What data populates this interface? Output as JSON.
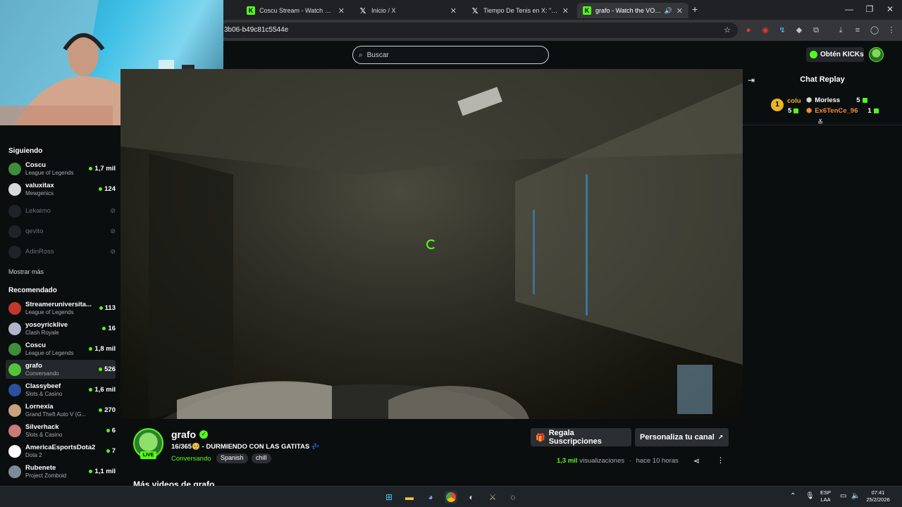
{
  "browser": {
    "tabs": [
      {
        "title": "Coscu Stream - Watch Live on K",
        "icon": "kick-favicon",
        "active": false
      },
      {
        "title": "Inicio / X",
        "icon": "x-favicon",
        "active": false
      },
      {
        "title": "Tiempo De Tenis en X: \"🤯 EL E",
        "icon": "x-favicon",
        "active": false
      },
      {
        "title": "grafo - Watch the VOD on K",
        "icon": "kick-favicon",
        "active": true
      }
    ],
    "new_tab": "+",
    "url": "3b06-b49c81c5544e"
  },
  "site": {
    "search_placeholder": "Buscar",
    "kicks_button": "Obtén KICKs"
  },
  "sidebar": {
    "following_title": "Siguiendo",
    "following": [
      {
        "name": "Coscu",
        "category": "League of Legends",
        "viewers": "1,7 mil",
        "live": true,
        "color": "#3e8e3a"
      },
      {
        "name": "valuxitax",
        "category": "Mewgenics",
        "viewers": "124",
        "live": true,
        "color": "#d9d9d9"
      },
      {
        "name": "Lekaimo",
        "category": "",
        "viewers": "",
        "live": false,
        "color": "#8a8f93"
      },
      {
        "name": "qevito",
        "category": "",
        "viewers": "",
        "live": false,
        "color": "#8a8f93"
      },
      {
        "name": "AdinRoss",
        "category": "",
        "viewers": "",
        "live": false,
        "color": "#8a8f93"
      }
    ],
    "show_more": "Mostrar más",
    "recommended_title": "Recomendado",
    "recommended": [
      {
        "name": "Streameruniversita...",
        "category": "League of Legends",
        "viewers": "113",
        "color": "#c0392b"
      },
      {
        "name": "yosoyricklive",
        "category": "Clash Royale",
        "viewers": "16",
        "color": "#b0b6c9"
      },
      {
        "name": "Coscu",
        "category": "League of Legends",
        "viewers": "1,8 mil",
        "color": "#3e8e3a"
      },
      {
        "name": "grafo",
        "category": "Conversando",
        "viewers": "526",
        "color": "#53c43a",
        "selected": true
      },
      {
        "name": "Classybeef",
        "category": "Slots & Casino",
        "viewers": "1,6 mil",
        "color": "#2c4f9e"
      },
      {
        "name": "Lornexia",
        "category": "Grand Theft Auto V (G...",
        "viewers": "270",
        "color": "#c9a27e"
      },
      {
        "name": "Silverhack",
        "category": "Slots & Casino",
        "viewers": "6",
        "color": "#c97b7b"
      },
      {
        "name": "AmericaEsportsDota2",
        "category": "Dota 2",
        "viewers": "7",
        "color": "#ffffff"
      },
      {
        "name": "Rubenete",
        "category": "Project Zomboid",
        "viewers": "1,1 mil",
        "color": "#7d8b99"
      }
    ]
  },
  "chat": {
    "title": "Chat Replay",
    "gifters": [
      {
        "rank": "1",
        "name": "colu",
        "count": "5",
        "color": "#e8b52a"
      },
      {
        "name": "Morless",
        "count": "5",
        "color": "#ffffff"
      },
      {
        "name": "Ex6TenCe_96",
        "count": "1",
        "color": "#f08a3c"
      }
    ]
  },
  "channel": {
    "name": "grafo",
    "live_badge": "LIVE",
    "title": "16/365🥺 - DURMIENDO CON LAS GATITAS 💤",
    "category": "Conversando",
    "tags": [
      "Spanish",
      "chill"
    ],
    "gift_subs_button": "Regala Suscripciones",
    "customize_button": "Personaliza tu canal",
    "views_count": "1,3 mil",
    "views_label": "visualizaciones",
    "time_ago": "hace 10 horas",
    "more_videos": "Más videos de grafo"
  },
  "taskbar": {
    "lang": "ESP",
    "lang2": "LAA",
    "time": "07:41",
    "date": "25/2/2026"
  },
  "colors": {
    "accent": "#53fc18",
    "background": "#0b0e0f",
    "button": "#2b2f33"
  }
}
